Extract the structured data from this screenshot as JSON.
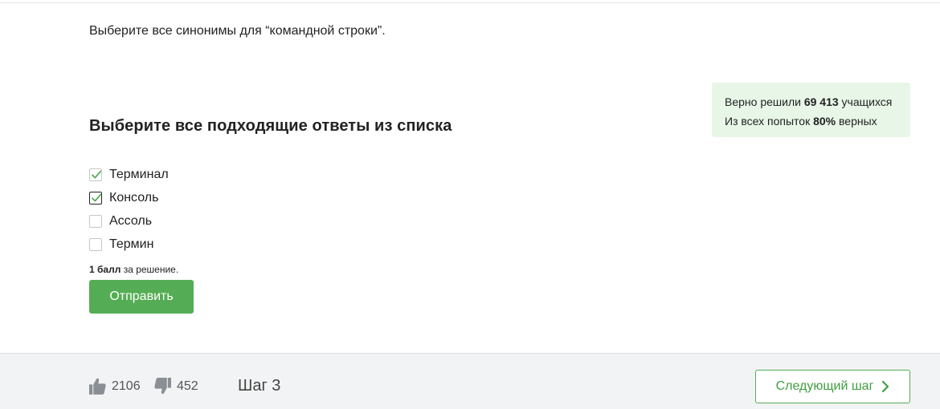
{
  "question": "Выберите все синонимы для “командной строки”.",
  "stats": {
    "line1_prefix": "Верно решили",
    "line1_count": "69 413",
    "line1_suffix": "учащихся",
    "line2_prefix": "Из всех попыток",
    "line2_percent": "80%",
    "line2_suffix": "верных"
  },
  "prompt": "Выберите все подходящие ответы из списка",
  "options": [
    {
      "label": "Терминал",
      "checked": true
    },
    {
      "label": "Консоль",
      "checked": true
    },
    {
      "label": "Ассоль",
      "checked": false
    },
    {
      "label": "Термин",
      "checked": false
    }
  ],
  "score": {
    "points": "1 балл",
    "suffix": "за решение."
  },
  "submit_label": "Отправить",
  "footer": {
    "likes": "2106",
    "dislikes": "452",
    "step_title": "Шаг 3",
    "next_label": "Следующий шаг"
  },
  "colors": {
    "accent": "#54ad54",
    "stats_bg": "#e8f6e8",
    "footer_bg": "#f2f3f4"
  }
}
